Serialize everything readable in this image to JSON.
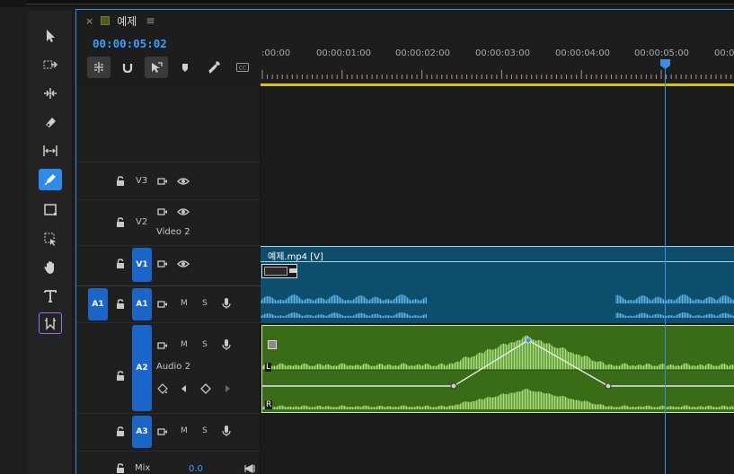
{
  "panel": {
    "close": "×",
    "title": "예제",
    "menu": "≡"
  },
  "timecode": "00:00:05:02",
  "ruler": {
    "labels": [
      ":00:00",
      "00:00:01:00",
      "00:00:02:00",
      "00:00:03:00",
      "00:00:04:00",
      "00:00:05:00",
      "00:0"
    ]
  },
  "tools": [
    "selection-tool",
    "track-select-forward-tool",
    "ripple-edit-tool",
    "razor-tool",
    "slip-tool",
    "pen-tool",
    "rectangle-tool",
    "hand-tool-alt",
    "hand-tool",
    "type-tool",
    "remix-tool"
  ],
  "tracks": {
    "v3": {
      "label": "V3"
    },
    "v2": {
      "label": "V2",
      "name": "Video 2"
    },
    "v1": {
      "label": "V1",
      "source": ""
    },
    "a1": {
      "label": "A1",
      "source": "A1",
      "m": "M",
      "s": "S"
    },
    "a2": {
      "label": "A2",
      "name": "Audio 2",
      "m": "M",
      "s": "S"
    },
    "a3": {
      "label": "A3",
      "m": "M",
      "s": "S"
    },
    "mix": {
      "label": "Mix",
      "value": "0.0"
    }
  },
  "clips": {
    "v1_clip_name": "예제.mp4 [V]",
    "a2_channel_left": "L",
    "a2_channel_right": "R"
  },
  "colors": {
    "accent": "#2d8ceb",
    "video_clip": "#0c4e6b",
    "audio_clip": "#3a6b16",
    "waveform": "#a8e07c",
    "work_area": "#d8c400"
  }
}
